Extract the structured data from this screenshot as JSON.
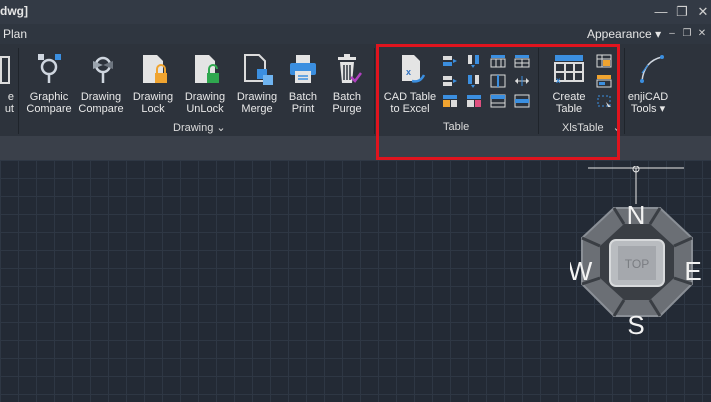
{
  "titlebar": {
    "title": "dwg]",
    "minimize": "—",
    "restore": "❐",
    "close": "✕"
  },
  "menubar": {
    "tab": "Plan",
    "appearance": "Appearance",
    "appearance_arrow": "▾",
    "minimize": "–",
    "restore": "❐",
    "close": "✕"
  },
  "ribbon": {
    "left_partial_labels": [
      "e",
      "ut"
    ],
    "drawing": {
      "group_label": "Drawing",
      "group_arrow": "⌄",
      "buttons": [
        {
          "l1": "Graphic",
          "l2": "Compare",
          "icon": "graphic-compare-icon"
        },
        {
          "l1": "Drawing",
          "l2": "Compare",
          "icon": "drawing-compare-icon"
        },
        {
          "l1": "Drawing",
          "l2": "Lock",
          "icon": "lock-icon"
        },
        {
          "l1": "Drawing",
          "l2": "UnLock",
          "icon": "unlock-icon"
        },
        {
          "l1": "Drawing",
          "l2": "Merge",
          "icon": "merge-icon"
        },
        {
          "l1": "Batch",
          "l2": "Print",
          "icon": "printer-icon"
        },
        {
          "l1": "Batch",
          "l2": "Purge",
          "icon": "trash-icon"
        }
      ]
    },
    "table": {
      "group_label": "Table",
      "main_button": {
        "l1": "CAD Table",
        "l2": "to Excel",
        "icon": "cad-table-to-excel-icon"
      }
    },
    "xlstable": {
      "group_label": "XlsTable",
      "group_arrow": "⌄",
      "main_button": {
        "l1": "Create",
        "l2": "Table",
        "icon": "create-table-icon"
      }
    },
    "tools": {
      "l1": "enjiCAD",
      "l2": "Tools",
      "arrow": "▾",
      "icon": "tools-icon"
    }
  },
  "viewcube": {
    "n": "N",
    "s": "S",
    "e": "E",
    "w": "W",
    "top": "TOP"
  },
  "colors": {
    "highlight": "#e0141e",
    "ribbon_bg": "#2d333c",
    "canvas_bg": "#232a35",
    "accent_blue": "#3b8fe0"
  }
}
